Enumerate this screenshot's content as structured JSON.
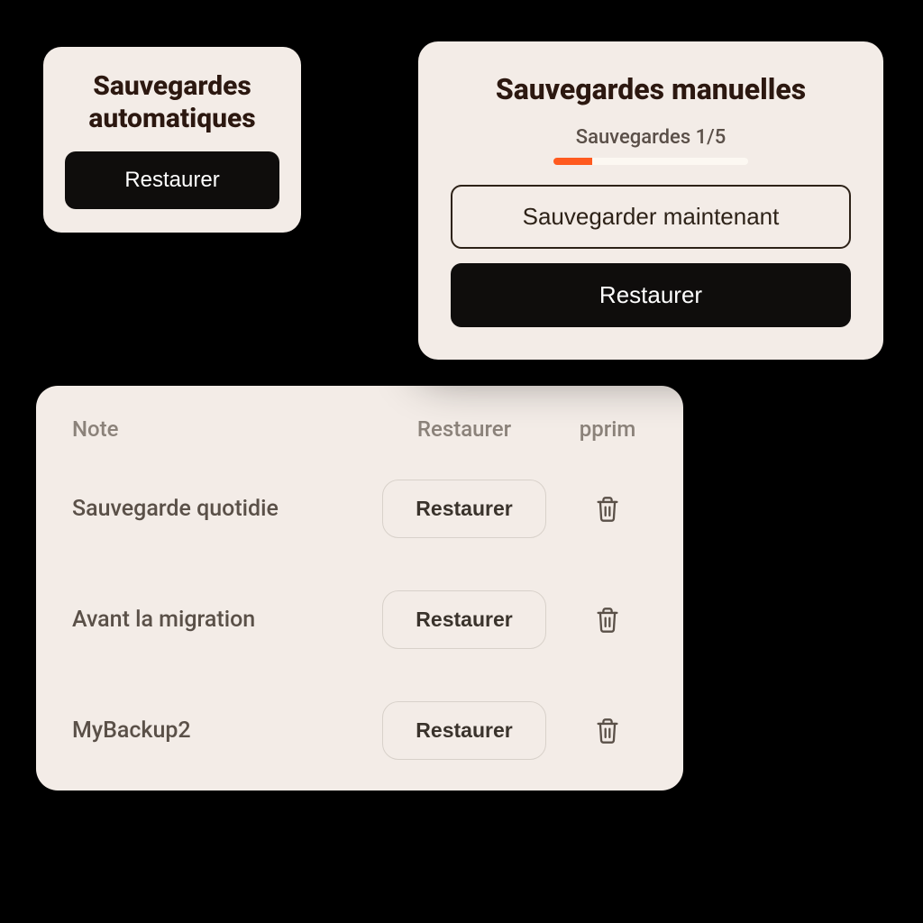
{
  "auto": {
    "title_line1": "Sauvegardes",
    "title_line2": "automatiques",
    "restore_label": "Restaurer"
  },
  "manual": {
    "title": "Sauvegardes manuelles",
    "count_label": "Sauvegardes 1/5",
    "progress_percent": 20,
    "save_now_label": "Sauvegarder maintenant",
    "restore_label": "Restaurer"
  },
  "list": {
    "headers": {
      "note": "Note",
      "restore": "Restaurer",
      "delete": "pprim"
    },
    "rows": [
      {
        "label": "Sauvegarde quotidie",
        "button": "Restaurer"
      },
      {
        "label": "Avant la migration",
        "button": "Restaurer"
      },
      {
        "label": "MyBackup2",
        "button": "Restaurer"
      }
    ]
  },
  "colors": {
    "accent": "#ff5a1f",
    "card_bg": "#f3ece7",
    "button_black": "#0f0d0c"
  }
}
